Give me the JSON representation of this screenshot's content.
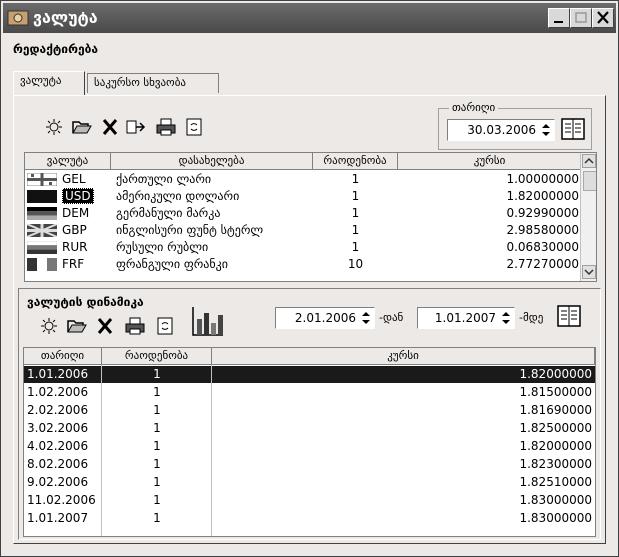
{
  "window": {
    "title": "ვალუტა"
  },
  "menu": {
    "edit": "რედაქტირება"
  },
  "tabs": [
    {
      "label": "ვალუტა"
    },
    {
      "label": "საკურსო სხვაობა"
    }
  ],
  "date_group": {
    "label": "თარიღი",
    "value": "30.03.2006"
  },
  "currencies": {
    "headers": {
      "currency": "ვალუტა",
      "name": "დასახელება",
      "quantity": "რაოდენობა",
      "rate": "კურსი"
    },
    "rows": [
      {
        "code": "GEL",
        "name": "ქართული ლარი",
        "quantity": "1",
        "rate": "1.00000000"
      },
      {
        "code": "USD",
        "name": "ამერიკული დოლარი",
        "quantity": "1",
        "rate": "1.82000000"
      },
      {
        "code": "DEM",
        "name": "გერმანული მარკა",
        "quantity": "1",
        "rate": "0.92990000"
      },
      {
        "code": "GBP",
        "name": "ინგლისური ფუნტ სტერლ",
        "quantity": "1",
        "rate": "2.98580000"
      },
      {
        "code": "RUR",
        "name": "რუსული რუბლი",
        "quantity": "1",
        "rate": "0.06830000"
      },
      {
        "code": "FRF",
        "name": "ფრანგული ფრანკი",
        "quantity": "10",
        "rate": "2.77270000"
      }
    ]
  },
  "dynamics": {
    "title": "ვალუტის დინამიკა",
    "from": "2.01.2006",
    "from_suffix": "-დან",
    "to": "1.01.2007",
    "to_suffix": "-მდე",
    "headers": {
      "date": "თარიღი",
      "quantity": "რაოდენობა",
      "rate": "კურსი"
    },
    "rows": [
      {
        "date": "1.01.2006",
        "quantity": "1",
        "rate": "1.82000000"
      },
      {
        "date": "1.02.2006",
        "quantity": "1",
        "rate": "1.81500000"
      },
      {
        "date": "2.02.2006",
        "quantity": "1",
        "rate": "1.81690000"
      },
      {
        "date": "3.02.2006",
        "quantity": "1",
        "rate": "1.82500000"
      },
      {
        "date": "4.02.2006",
        "quantity": "1",
        "rate": "1.82000000"
      },
      {
        "date": "8.02.2006",
        "quantity": "1",
        "rate": "1.82300000"
      },
      {
        "date": "9.02.2006",
        "quantity": "1",
        "rate": "1.82510000"
      },
      {
        "date": "11.02.2006",
        "quantity": "1",
        "rate": "1.83000000"
      },
      {
        "date": "1.01.2007",
        "quantity": "1",
        "rate": "1.83000000"
      }
    ]
  },
  "colors": {
    "title_bar": "#555555",
    "selection": "#1a1a1a",
    "panel": "#ece9e6"
  }
}
